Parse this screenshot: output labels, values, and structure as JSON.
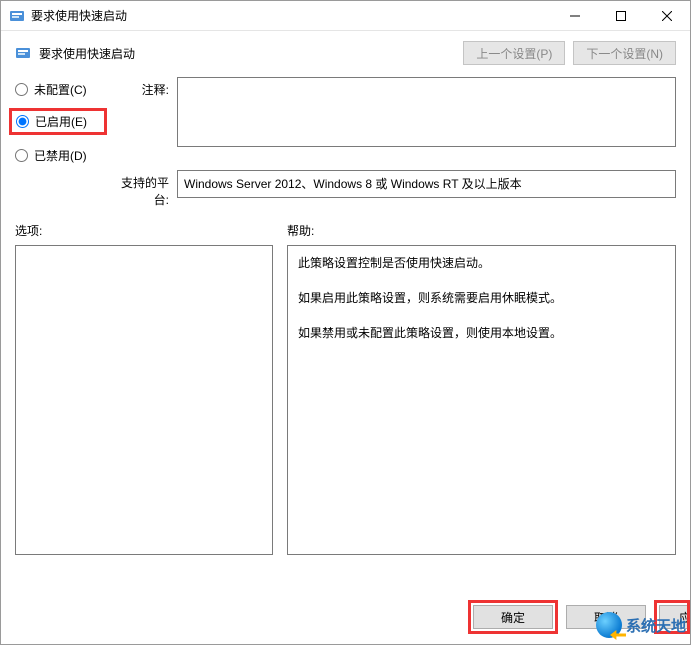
{
  "titlebar": {
    "title": "要求使用快速启动"
  },
  "header": {
    "title": "要求使用快速启动",
    "prev_button": "上一个设置(P)",
    "next_button": "下一个设置(N)"
  },
  "radios": {
    "not_configured": "未配置(C)",
    "enabled": "已启用(E)",
    "disabled": "已禁用(D)",
    "selected": "enabled"
  },
  "labels": {
    "comment": "注释:",
    "platform": "支持的平台:",
    "options": "选项:",
    "help": "帮助:"
  },
  "comment_value": "",
  "platform_text": "Windows Server 2012、Windows 8 或 Windows RT 及以上版本",
  "options_text": "",
  "help_paragraphs": [
    "此策略设置控制是否使用快速启动。",
    "如果启用此策略设置，则系统需要启用休眠模式。",
    "如果禁用或未配置此策略设置，则使用本地设置。"
  ],
  "footer": {
    "ok": "确定",
    "cancel": "取消",
    "apply": "应用(A)"
  },
  "watermark": "系统天地"
}
